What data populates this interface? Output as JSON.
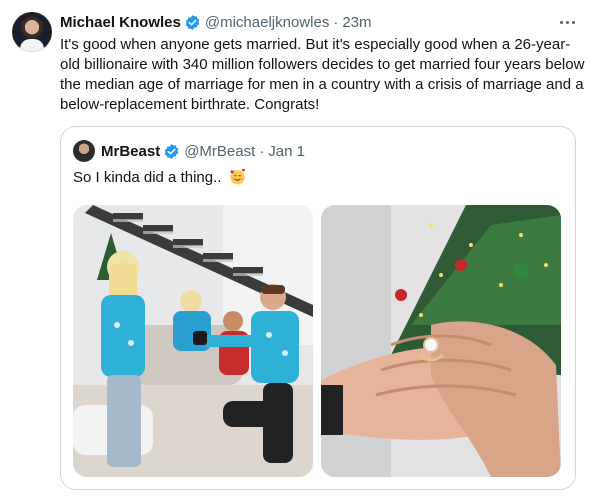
{
  "tweet": {
    "author_name": "Michael Knowles",
    "author_handle": "@michaeljknowles",
    "separator": "·",
    "time": "23m",
    "text": "It's good when anyone gets married. But it's especially good when a 26-year-old billionaire with 340 million followers decides to get married four years below the median age of marriage for men in a country with a crisis of marriage and a below-replacement birthrate. Congrats!",
    "verified_icon": "verified-badge-icon",
    "more_icon": "more-options-icon"
  },
  "quoted": {
    "author_name": "MrBeast",
    "author_handle": "@MrBeast",
    "separator": "·",
    "date": "Jan 1",
    "text": "So I kinda did a thing..",
    "emoji": "smiling-face-with-hearts-emoji",
    "images": [
      "proposal-photo-icon",
      "engagement-ring-photo-icon"
    ]
  },
  "colors": {
    "text": "#0f1419",
    "secondary": "#536471",
    "verified": "#1d9bf0",
    "border": "#cfd9de"
  }
}
